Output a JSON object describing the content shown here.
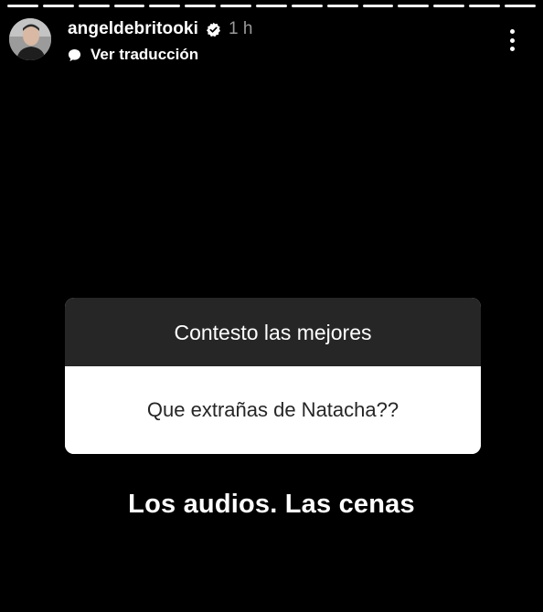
{
  "story": {
    "progress_segments": 15,
    "progress_color": "#f2f2f2",
    "background_color": "#000000"
  },
  "header": {
    "username": "angeldebritooki",
    "verified_icon": "verified-badge-icon",
    "time_ago": "1 h",
    "translate_icon": "speech-bubble-icon",
    "translate_label": "Ver traducción",
    "more_icon": "more-vertical-icon"
  },
  "question_sticker": {
    "prompt": "Contesto las mejores",
    "question": "Que extrañas de Natacha??",
    "header_color": "#262626"
  },
  "answer_text": "Los audios. Las cenas"
}
